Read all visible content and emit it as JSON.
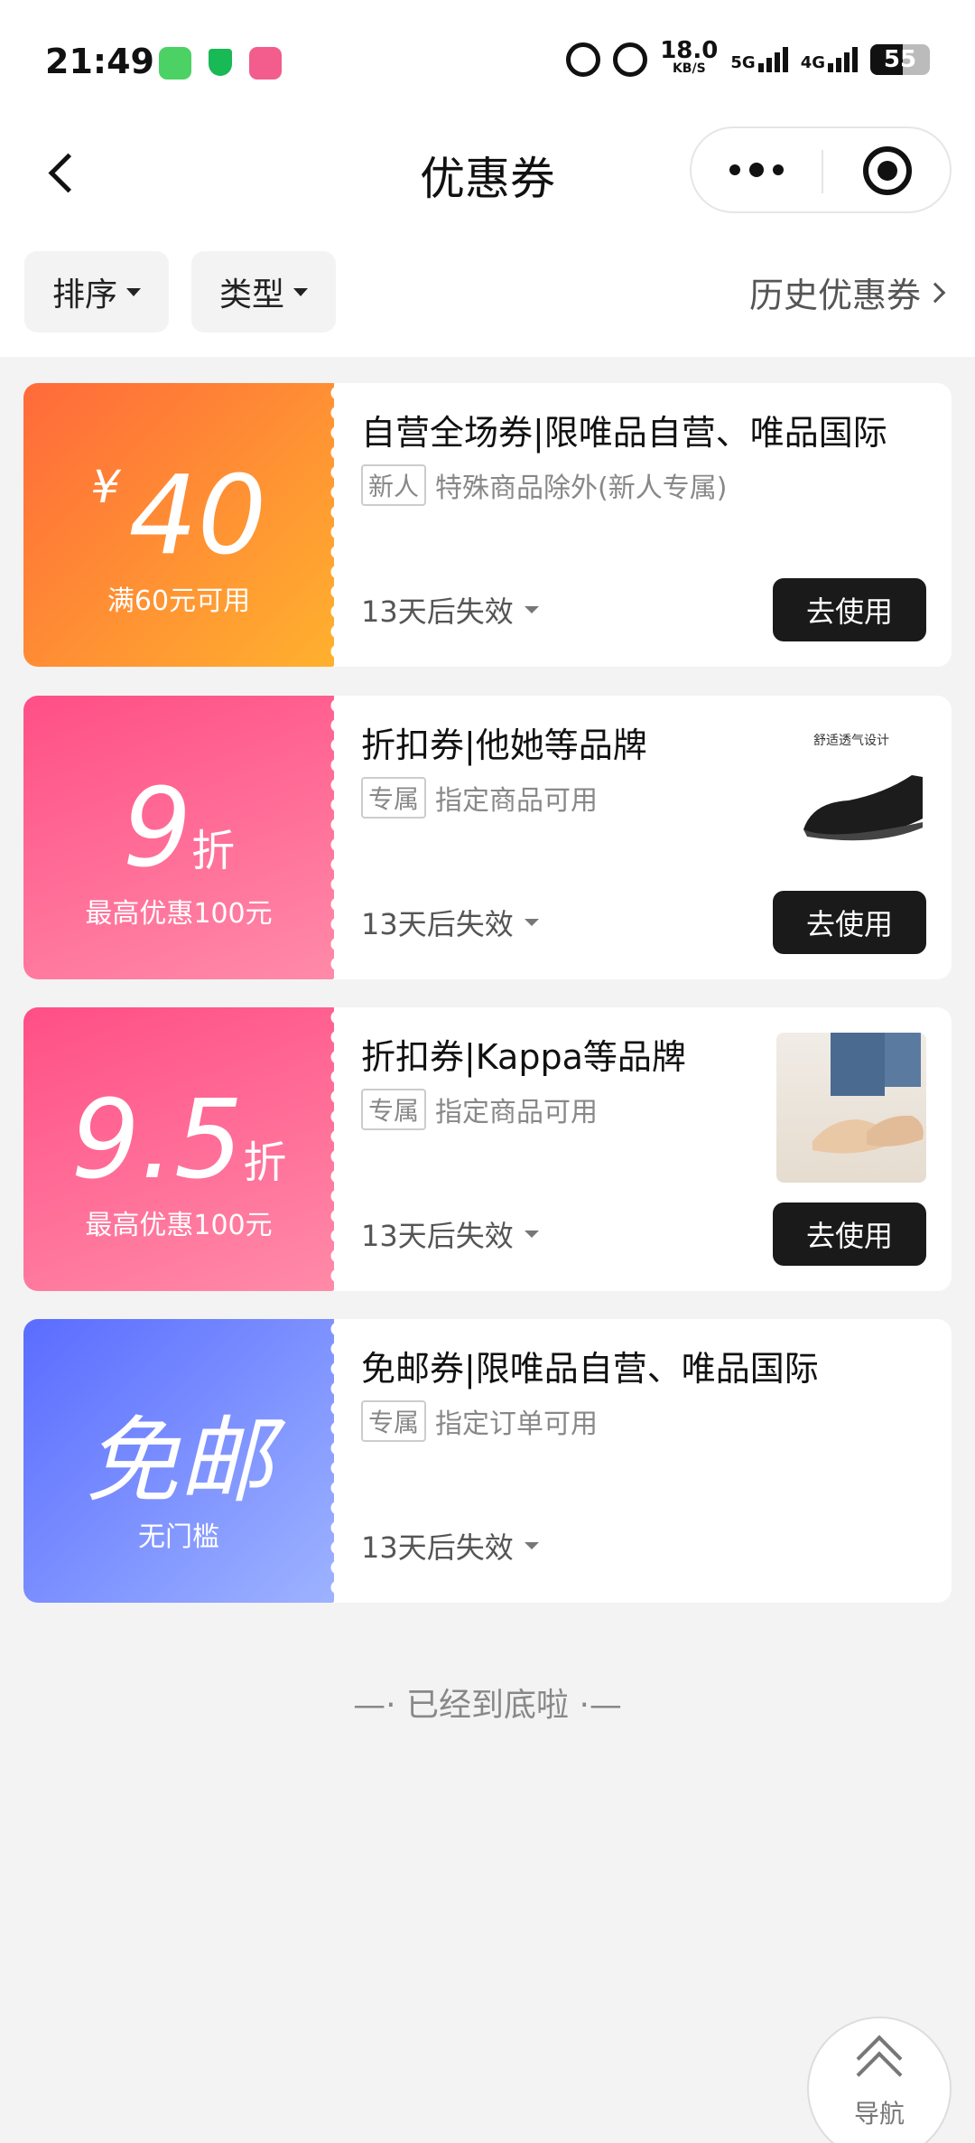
{
  "status_bar": {
    "time": "21:49",
    "net_speed": "18.0",
    "net_unit": "KB/S",
    "signal_1": "5G",
    "signal_2": "4G",
    "battery": "55",
    "battery_level_percent": 55
  },
  "header": {
    "title": "优惠券",
    "back_icon": "chevron-left-icon",
    "more_icon": "more-dots-icon",
    "close_icon": "target-circle-icon"
  },
  "filters": {
    "sort_label": "排序",
    "type_label": "类型",
    "history_label": "历史优惠券"
  },
  "coupons": [
    {
      "yen": "¥",
      "amount": "40",
      "condition": "满60元可用",
      "title": "自营全场券|限唯品自营、唯品国际",
      "badge": "新人",
      "desc": "特殊商品除外(新人专属)",
      "expire": "13天后失效",
      "button": "去使用",
      "color": "#ff7a33"
    },
    {
      "amount": "9",
      "unit": "折",
      "condition": "最高优惠100元",
      "title": "折扣券|他她等品牌",
      "badge": "专属",
      "desc": "指定商品可用",
      "expire": "13天后失效",
      "button": "去使用",
      "thumb_caption": "舒适透气设计",
      "color": "#ff5a8c"
    },
    {
      "amount": "9.5",
      "unit": "折",
      "condition": "最高优惠100元",
      "title": "折扣券|Kappa等品牌",
      "badge": "专属",
      "desc": "指定商品可用",
      "expire": "13天后失效",
      "button": "去使用",
      "color": "#ff5a8c"
    },
    {
      "amount": "免邮",
      "condition": "无门槛",
      "title": "免邮券|限唯品自营、唯品国际",
      "badge": "专属",
      "desc": "指定订单可用",
      "expire": "13天后失效",
      "color": "#6e80ff"
    }
  ],
  "end_text": "—· 已经到底啦 ·—",
  "nav_fab": {
    "label": "导航",
    "icon": "double-chevron-up-icon"
  }
}
